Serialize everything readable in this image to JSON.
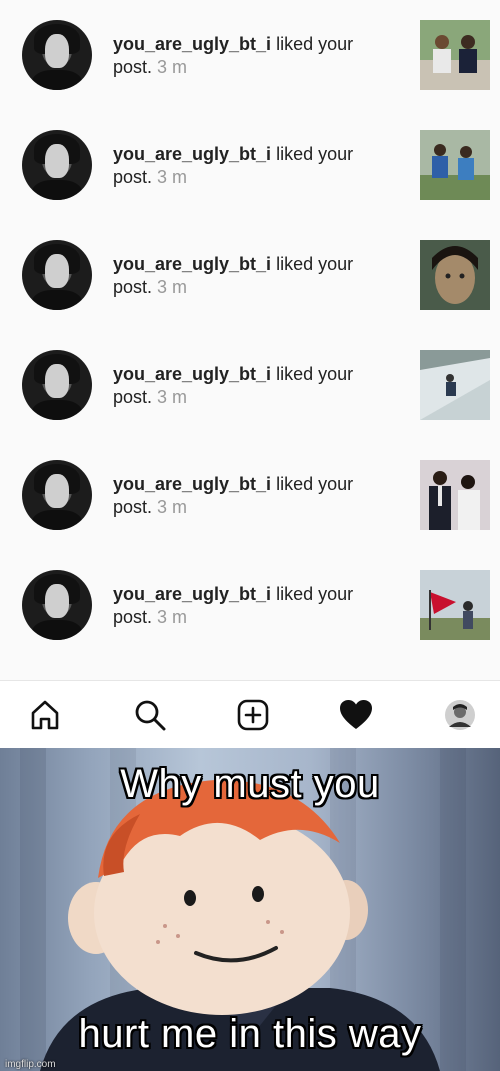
{
  "notifications": [
    {
      "username": "you_are_ugly_bt_i",
      "action": "liked your",
      "object": "post.",
      "time": "3 m",
      "thumb": "two-people-outdoors"
    },
    {
      "username": "you_are_ugly_bt_i",
      "action": "liked your",
      "object": "post.",
      "time": "3 m",
      "thumb": "two-people-sitting"
    },
    {
      "username": "you_are_ugly_bt_i",
      "action": "liked your",
      "object": "post.",
      "time": "3 m",
      "thumb": "face-closeup"
    },
    {
      "username": "you_are_ugly_bt_i",
      "action": "liked your",
      "object": "post.",
      "time": "3 m",
      "thumb": "person-on-snow"
    },
    {
      "username": "you_are_ugly_bt_i",
      "action": "liked your",
      "object": "post.",
      "time": "3 m",
      "thumb": "couple-formal"
    },
    {
      "username": "you_are_ugly_bt_i",
      "action": "liked your",
      "object": "post.",
      "time": "3 m",
      "thumb": "person-with-flag"
    }
  ],
  "nav": {
    "items": [
      "home-icon",
      "search-icon",
      "add-post-icon",
      "heart-icon",
      "profile-avatar"
    ]
  },
  "meme": {
    "top_caption": "Why must you",
    "bottom_caption": "hurt me in this way"
  },
  "watermark": "imgflip.com"
}
